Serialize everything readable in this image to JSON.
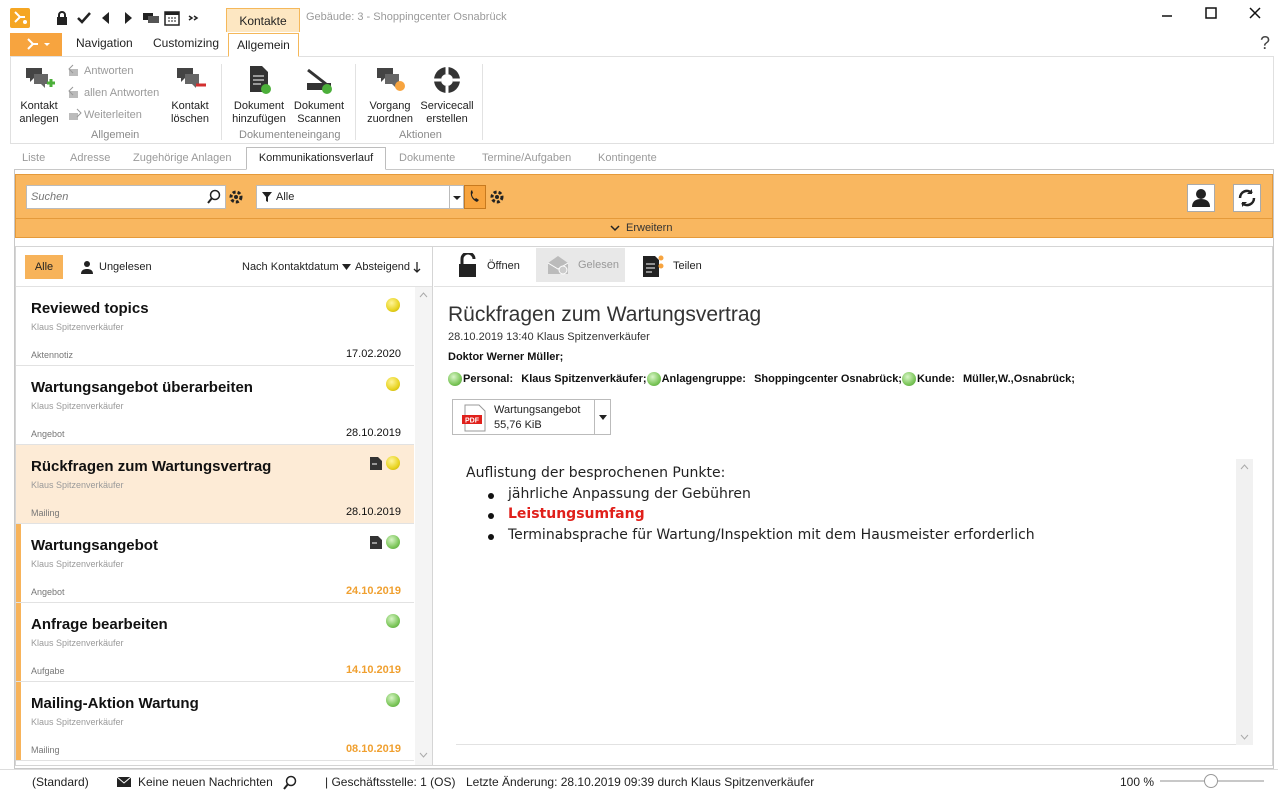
{
  "window": {
    "context_tab": "Kontakte",
    "doc_title": "Gebäude: 3 - Shoppingcenter Osnabrück",
    "help": "?"
  },
  "ribbon_tabs": [
    "Navigation",
    "Customizing",
    "Allgemein"
  ],
  "ribbon": {
    "kontakt_anlegen": [
      "Kontakt",
      "anlegen"
    ],
    "antworten": "Antworten",
    "allen_antworten": "allen Antworten",
    "weiterleiten": "Weiterleiten",
    "kontakt_loeschen": [
      "Kontakt",
      "löschen"
    ],
    "group_allgemein": "Allgemein",
    "dokument_hinzufuegen": [
      "Dokument",
      "hinzufügen"
    ],
    "dokument_scannen": [
      "Dokument",
      "Scannen"
    ],
    "group_dokumenteneingang": "Dokumenteneingang",
    "vorgang_zuordnen": [
      "Vorgang",
      "zuordnen"
    ],
    "servicecall_erstellen": [
      "Servicecall",
      "erstellen"
    ],
    "group_aktionen": "Aktionen"
  },
  "subtabs": [
    "Liste",
    "Adresse",
    "Zugehörige Anlagen",
    "Kommunikationsverlauf",
    "Dokumente",
    "Termine/Aufgaben",
    "Kontingente"
  ],
  "toolbar": {
    "search_placeholder": "Suchen",
    "filter_value": "Alle",
    "erweitern": "Erweitern"
  },
  "list_header": {
    "alle": "Alle",
    "ungelesen": "Ungelesen",
    "sort_field": "Nach Kontaktdatum",
    "sort_dir": "Absteigend"
  },
  "items": [
    {
      "title": "Reviewed topics",
      "author": "Klaus Spitzenverkäufer",
      "kind": "Aktennotiz",
      "date": "17.02.2020",
      "status": "yellow"
    },
    {
      "title": "Wartungsangebot überarbeiten",
      "author": "Klaus Spitzenverkäufer",
      "kind": "Angebot",
      "date": "28.10.2019",
      "status": "yellow"
    },
    {
      "title": "Rückfragen zum Wartungsvertrag",
      "author": "Klaus Spitzenverkäufer",
      "kind": "Mailing",
      "date": "28.10.2019",
      "status": "yellow"
    },
    {
      "title": "Wartungsangebot",
      "author": "Klaus Spitzenverkäufer",
      "kind": "Angebot",
      "date": "24.10.2019",
      "status": "green"
    },
    {
      "title": "Anfrage bearbeiten",
      "author": "Klaus Spitzenverkäufer",
      "kind": "Aufgabe",
      "date": "14.10.2019",
      "status": "green"
    },
    {
      "title": "Mailing-Aktion Wartung",
      "author": "Klaus Spitzenverkäufer",
      "kind": "Mailing",
      "date": "08.10.2019",
      "status": "green"
    }
  ],
  "actions": {
    "oeffnen": "Öffnen",
    "gelesen": "Gelesen",
    "teilen": "Teilen"
  },
  "detail": {
    "subject": "Rückfragen zum Wartungsvertrag",
    "meta": "28.10.2019 13:40 Klaus Spitzenverkäufer",
    "recipient": "Doktor Werner Müller;",
    "links": [
      {
        "label": "Personal:",
        "value": "Klaus Spitzenverkäufer;"
      },
      {
        "label": "Anlagengruppe:",
        "value": "Shoppingcenter Osnabrück;"
      },
      {
        "label": "Kunde:",
        "value": "Müller,W.,Osnabrück;"
      }
    ],
    "attachment": {
      "name": "Wartungsangebot",
      "size": "55,76 KiB",
      "badge": "PDF"
    },
    "body_intro": "Auflistung der besprochenen Punkte:",
    "bullets": [
      "jährliche Anpassung der Gebühren",
      "Leistungsumfang",
      "Terminabsprache für Wartung/Inspektion mit dem Hausmeister erforderlich"
    ]
  },
  "statusbar": {
    "layout": "(Standard)",
    "messages": "Keine neuen Nachrichten",
    "office": "| Geschäftsstelle:  1 (OS)",
    "last_change": "Letzte Änderung: 28.10.2019 09:39 durch Klaus Spitzenverkäufer",
    "zoom": "100 %"
  },
  "colors": {
    "accent": "#f7a43f",
    "toolbar": "#f9b760",
    "highlight_red": "#e0201b",
    "highlight_orange": "#f0a030"
  }
}
